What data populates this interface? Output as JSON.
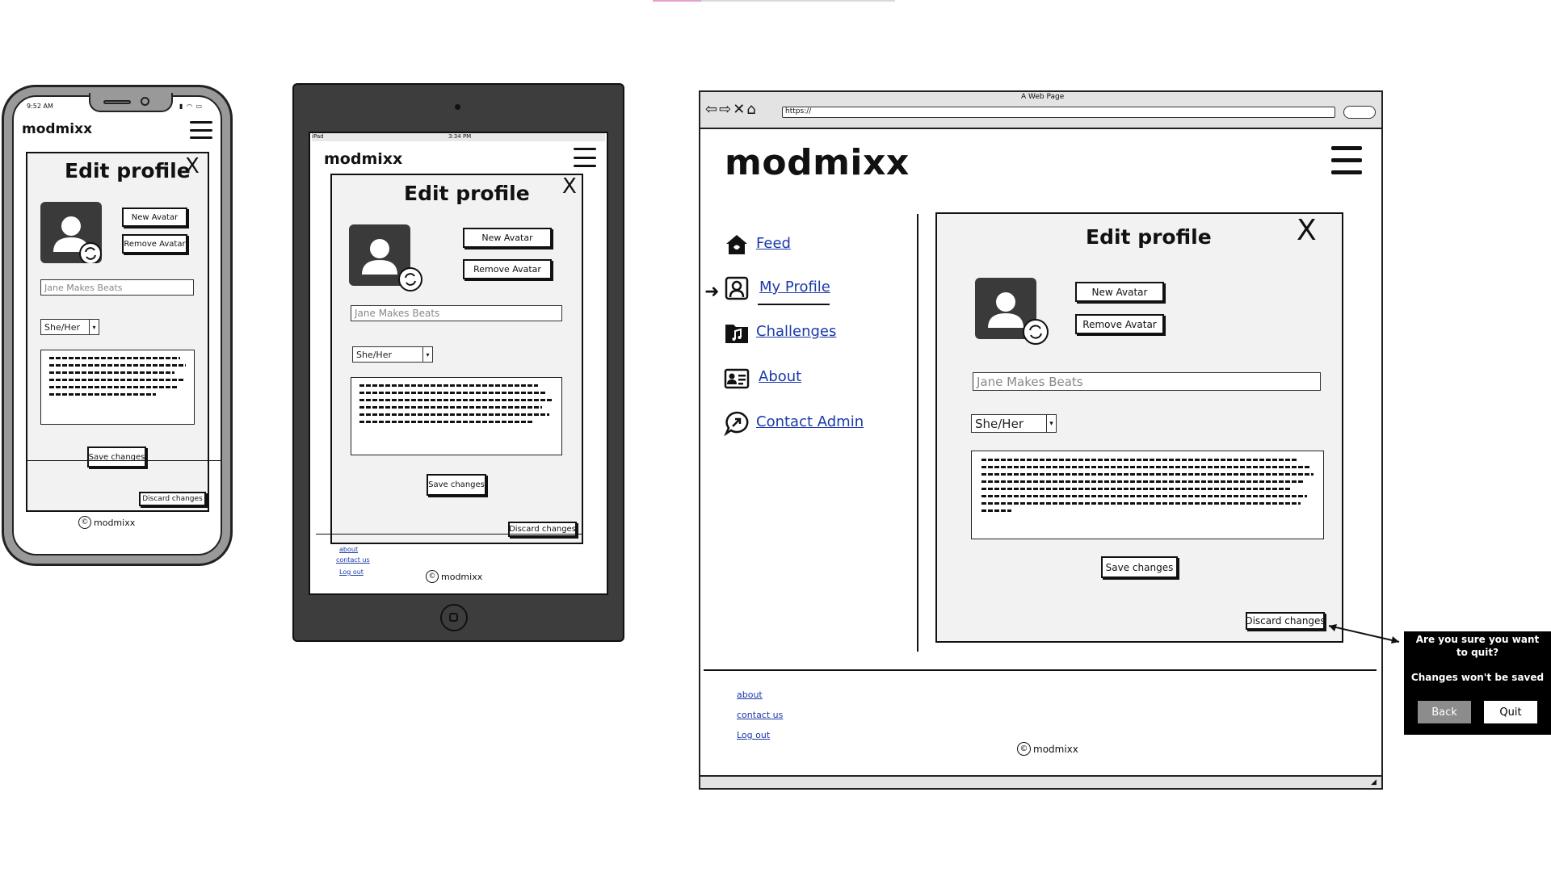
{
  "brand": {
    "name": "modmixx"
  },
  "edit_profile": {
    "title": "Edit profile",
    "close_symbol": "X",
    "new_avatar": "New Avatar",
    "remove_avatar": "Remove Avatar",
    "name_placeholder": "Jane Makes Beats",
    "pronouns_value": "She/Her",
    "save_changes": "Save changes",
    "discard_changes": "Discard changes"
  },
  "footer": {
    "about": "about",
    "contact": "contact us",
    "logout": "Log out",
    "copyright_symbol": "©",
    "copyright_text": "modmixx"
  },
  "phone": {
    "status_time": "9:52 AM"
  },
  "tablet": {
    "status_left": "iPad",
    "status_time": "3:34 PM"
  },
  "browser": {
    "page_title": "A Web Page",
    "url": "https://",
    "nav_items": [
      {
        "label": "Feed",
        "icon": "home-icon"
      },
      {
        "label": "My Profile",
        "icon": "profile-icon",
        "active": true
      },
      {
        "label": "Challenges",
        "icon": "music-folder-icon"
      },
      {
        "label": "About",
        "icon": "id-card-icon"
      },
      {
        "label": "Contact Admin",
        "icon": "chat-icon"
      }
    ]
  },
  "confirm_popup": {
    "question": "Are you sure you want to quit?",
    "message": "Changes won't be saved",
    "back": "Back",
    "quit": "Quit"
  },
  "colors": {
    "link": "#1a3aa8",
    "device_gray": "#999999",
    "tablet_dark": "#3d3d3d"
  }
}
